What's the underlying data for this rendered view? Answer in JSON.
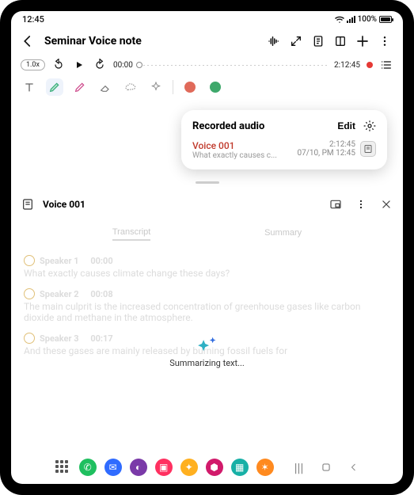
{
  "status": {
    "time": "12:45",
    "battery": "100%"
  },
  "header": {
    "title": "Seminar Voice note"
  },
  "player": {
    "speed": "1.0x",
    "elapsed": "00:00",
    "total": "2:12:45"
  },
  "panel": {
    "title": "Recorded audio",
    "edit": "Edit",
    "item": {
      "name": "Voice 001",
      "preview": "What exactly causes c...",
      "duration": "2:12:45",
      "date": "07/10, PM 12:45"
    }
  },
  "pane": {
    "title": "Voice 001"
  },
  "tabs": {
    "transcript": "Transcript",
    "summary": "Summary"
  },
  "transcript": {
    "s1": {
      "speaker": "Speaker 1",
      "time": "00:00",
      "text": "What exactly causes climate change these days?"
    },
    "s2": {
      "speaker": "Speaker 2",
      "time": "00:08",
      "text": "The main culprit is the increased concentration of greenhouse gases like carbon dioxide and methane in the atmosphere."
    },
    "s3": {
      "speaker": "Speaker 3",
      "time": "00:17",
      "text": "And these gases are mainly released by burning fossil fuels for"
    }
  },
  "overlay": {
    "label": "Summarizing text..."
  },
  "colors": {
    "swatch1": "#e06a5a",
    "swatch2": "#3ea86b"
  },
  "apps": {
    "phone": "#1fbf5f",
    "messages": "#2f6bff",
    "browser": "#7a3aa8",
    "flip": "#ff3060",
    "notes": "#ffb020",
    "store": "#d11a6b",
    "files": "#17b0a6",
    "mail": "#ff8a1f"
  }
}
